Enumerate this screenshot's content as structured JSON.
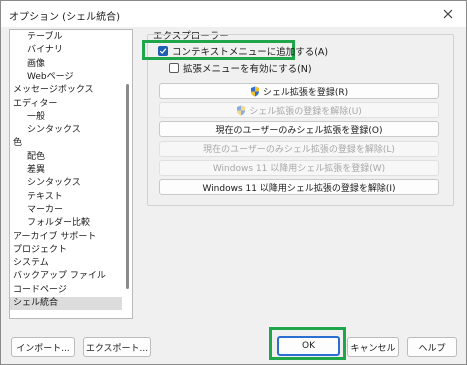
{
  "window": {
    "title": "オプション (シェル統合)"
  },
  "tree": {
    "items": [
      {
        "label": "テーブル",
        "indent": 1
      },
      {
        "label": "バイナリ",
        "indent": 1
      },
      {
        "label": "画像",
        "indent": 1
      },
      {
        "label": "Webページ",
        "indent": 1
      },
      {
        "label": "メッセージボックス",
        "indent": 0
      },
      {
        "label": "エディター",
        "indent": 0
      },
      {
        "label": "一般",
        "indent": 1
      },
      {
        "label": "シンタックス",
        "indent": 1
      },
      {
        "label": "色",
        "indent": 0
      },
      {
        "label": "配色",
        "indent": 1
      },
      {
        "label": "差異",
        "indent": 1
      },
      {
        "label": "シンタックス",
        "indent": 1
      },
      {
        "label": "テキスト",
        "indent": 1
      },
      {
        "label": "マーカー",
        "indent": 1
      },
      {
        "label": "フォルダー比較",
        "indent": 1
      },
      {
        "label": "アーカイブ サポート",
        "indent": 0
      },
      {
        "label": "プロジェクト",
        "indent": 0
      },
      {
        "label": "システム",
        "indent": 0
      },
      {
        "label": "バックアップ ファイル",
        "indent": 0
      },
      {
        "label": "コードページ",
        "indent": 0
      },
      {
        "label": "シェル統合",
        "indent": 0,
        "selected": true
      }
    ]
  },
  "explorer": {
    "group_label": "エクスプローラー",
    "context_menu_checkbox": {
      "label": "コンテキストメニューに追加する(A)",
      "checked": true
    },
    "extended_menu_checkbox": {
      "label": "拡張メニューを有効にする(N)",
      "checked": false
    },
    "buttons": [
      {
        "label": "シェル拡張を登録(R)",
        "shield": true,
        "enabled": true
      },
      {
        "label": "シェル拡張の登録を解除(U)",
        "shield": true,
        "enabled": false
      },
      {
        "label": "現在のユーザーのみシェル拡張を登録(O)",
        "shield": false,
        "enabled": true
      },
      {
        "label": "現在のユーザーのみシェル拡張の登録を解除(L)",
        "shield": false,
        "enabled": false
      },
      {
        "label": "Windows 11 以降用シェル拡張を登録(W)",
        "shield": false,
        "enabled": false
      },
      {
        "label": "Windows 11 以降用シェル拡張の登録を解除(I)",
        "shield": false,
        "enabled": true
      }
    ]
  },
  "footer": {
    "import_label": "インポート...",
    "export_label": "エクスポート...",
    "ok_label": "OK",
    "cancel_label": "キャンセル",
    "help_label": "ヘルプ"
  },
  "colors": {
    "highlight": "#1fa54a",
    "checkbox_accent": "#1f5fb3",
    "default_button_border": "#2a6fd1"
  }
}
